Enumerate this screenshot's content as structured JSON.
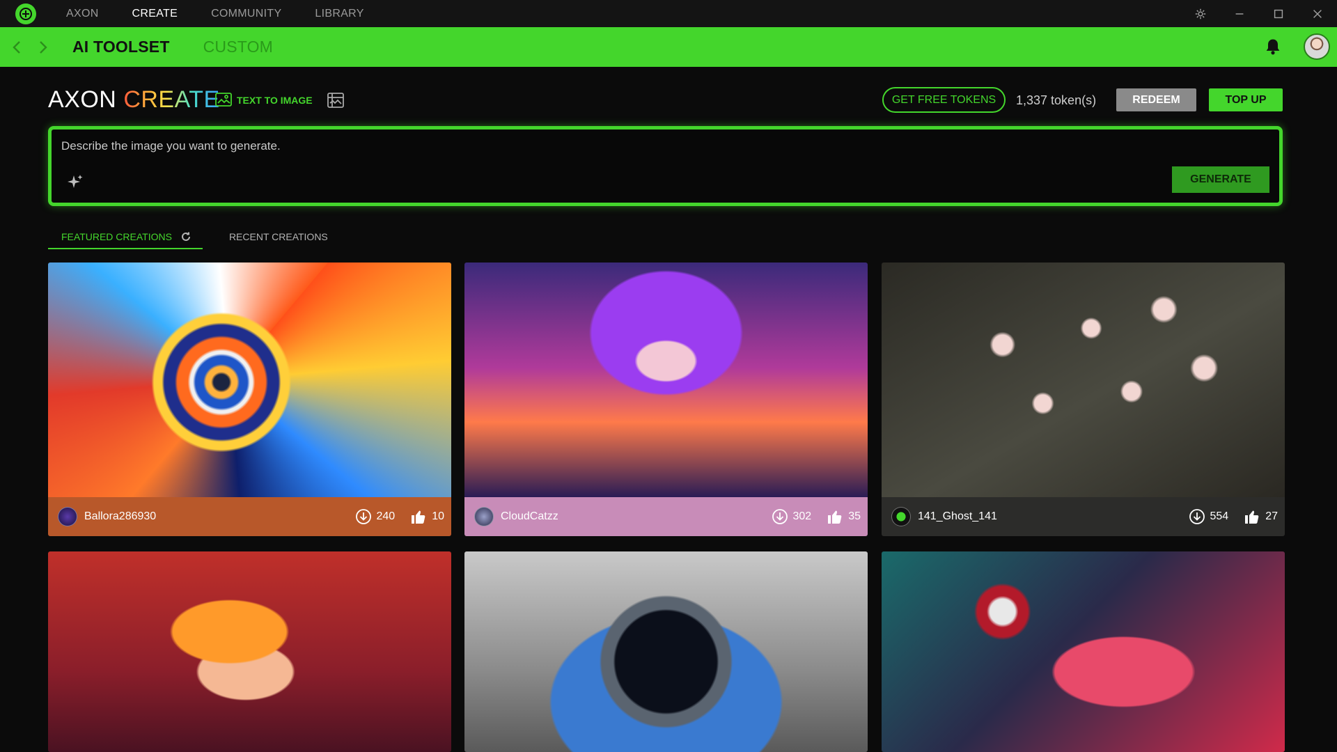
{
  "titlebar": {
    "nav": [
      {
        "label": "AXON",
        "active": false
      },
      {
        "label": "CREATE",
        "active": true
      },
      {
        "label": "COMMUNITY",
        "active": false
      },
      {
        "label": "LIBRARY",
        "active": false
      }
    ]
  },
  "subnav": {
    "tabs": [
      {
        "label": "AI TOOLSET",
        "active": true
      },
      {
        "label": "CUSTOM",
        "active": false
      }
    ]
  },
  "header": {
    "brand_part1": "AXON",
    "brand_part2": "CREATE",
    "mode_label": "TEXT TO IMAGE",
    "free_tokens_label": "GET FREE TOKENS",
    "tokens": "1,337 token(s)",
    "redeem_label": "REDEEM",
    "topup_label": "TOP UP"
  },
  "prompt": {
    "placeholder": "Describe the image you want to generate.",
    "value": "",
    "generate_label": "GENERATE"
  },
  "tabs": {
    "featured": "FEATURED CREATIONS",
    "recent": "RECENT CREATIONS"
  },
  "creations": [
    {
      "user": "Ballora286930",
      "downloads": "240",
      "likes": "10"
    },
    {
      "user": "CloudCatzz",
      "downloads": "302",
      "likes": "35"
    },
    {
      "user": "141_Ghost_141",
      "downloads": "554",
      "likes": "27"
    }
  ],
  "colors": {
    "accent": "#44d62c",
    "background": "#0b0b0b",
    "redeem": "#8a8a8a"
  }
}
